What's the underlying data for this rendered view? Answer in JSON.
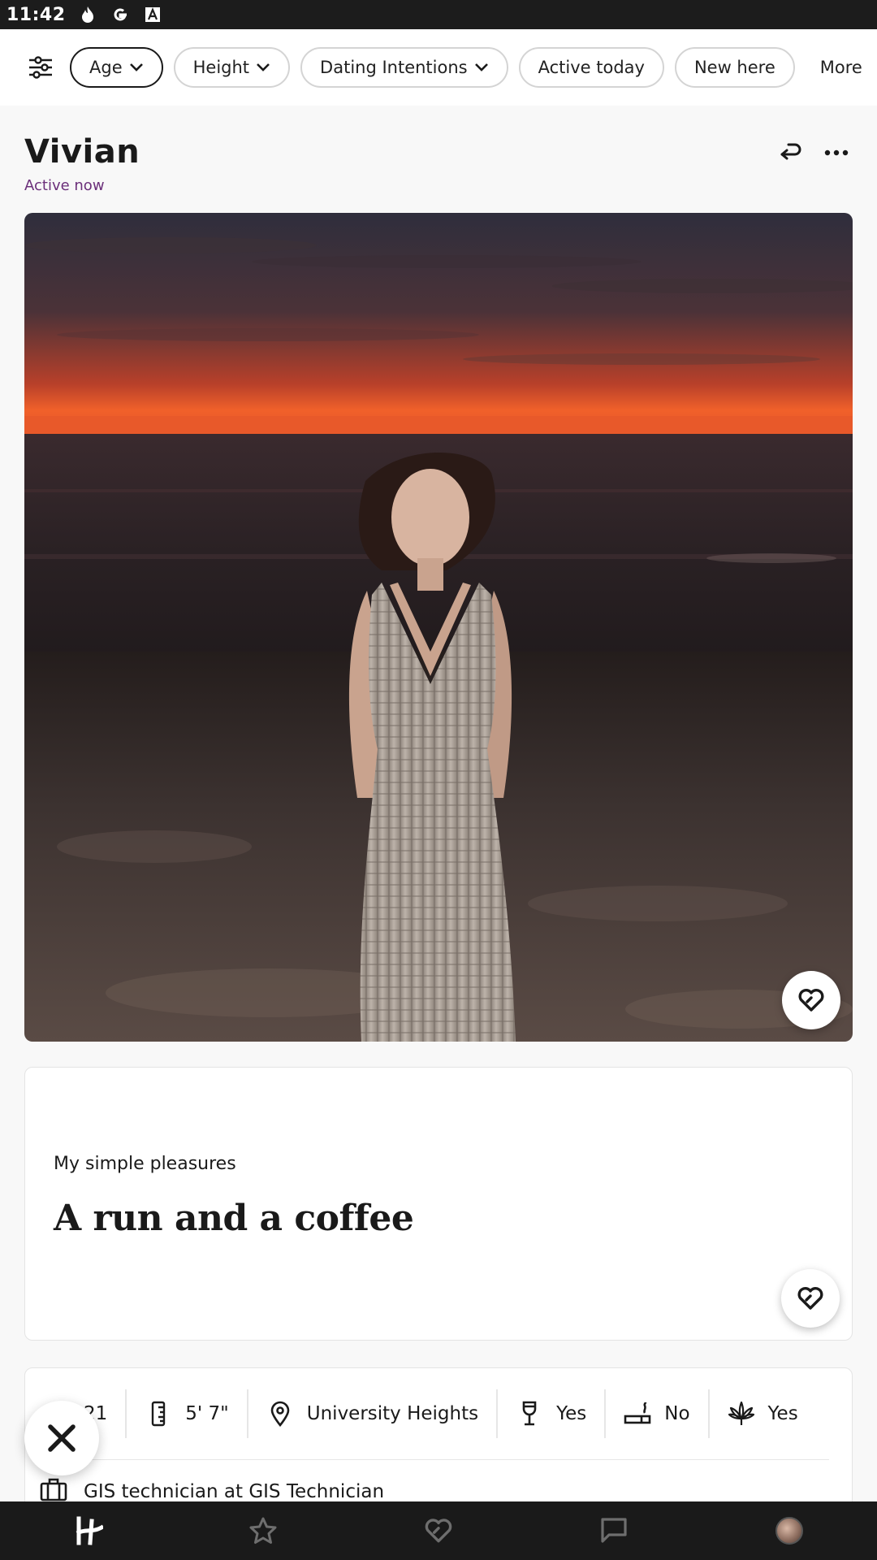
{
  "status_bar": {
    "time": "11:42",
    "icons": [
      "fire-icon",
      "google-icon",
      "font-icon"
    ]
  },
  "filters": {
    "chips": [
      {
        "label": "Age",
        "dropdown": true,
        "selected": true
      },
      {
        "label": "Height",
        "dropdown": true,
        "selected": false
      },
      {
        "label": "Dating Intentions",
        "dropdown": true,
        "selected": false
      },
      {
        "label": "Active today",
        "dropdown": false,
        "selected": false
      },
      {
        "label": "New here",
        "dropdown": false,
        "selected": false
      }
    ],
    "more_label": "More"
  },
  "profile": {
    "name": "Vivian",
    "status": "Active now",
    "status_color": "#6b2f7a"
  },
  "prompt": {
    "question": "My simple pleasures",
    "answer": "A run and a coffee"
  },
  "vitals": {
    "age": "21",
    "height": "5' 7\"",
    "location": "University Heights",
    "drinking": "Yes",
    "smoking": "No",
    "marijuana": "Yes",
    "job": "GIS technician at GIS Technician"
  },
  "nav": {
    "items": [
      "home-icon",
      "star-icon",
      "likes-icon",
      "chat-icon",
      "profile-avatar"
    ]
  },
  "colors": {
    "accent": "#6b2f7a",
    "nav_bg": "#1a1a1a"
  }
}
